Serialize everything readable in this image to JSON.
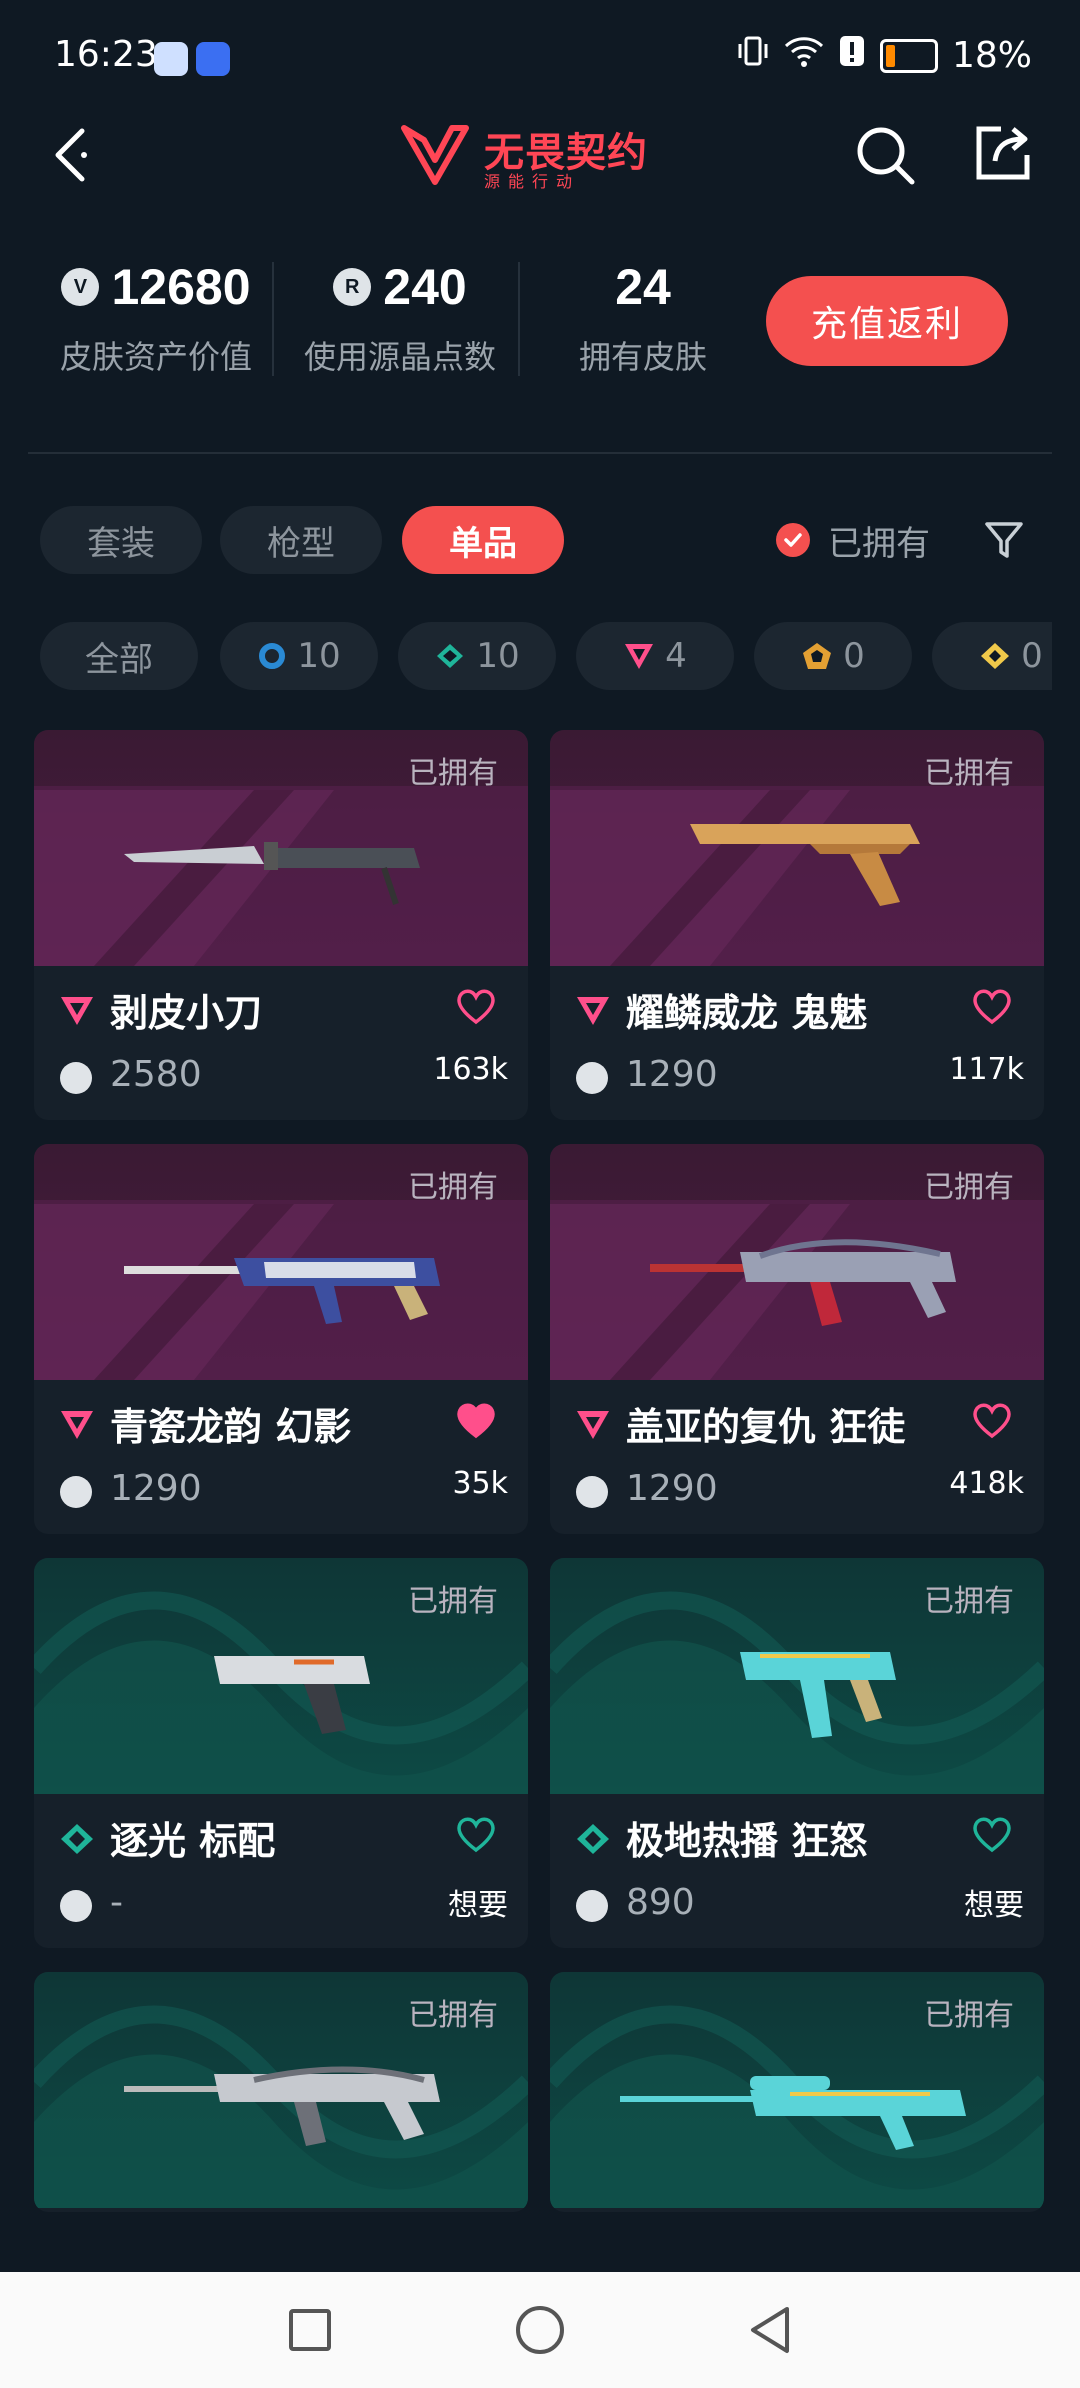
{
  "status_bar": {
    "time": "16:23",
    "battery": "18%"
  },
  "header": {
    "logo_name": "无畏契约",
    "logo_sub": "源能行动"
  },
  "stats": {
    "asset_value": "12680",
    "asset_label": "皮肤资产价值",
    "rp_used": "240",
    "rp_label": "使用源晶点数",
    "skins_owned": "24",
    "skins_label": "拥有皮肤",
    "recharge_label": "充值返利",
    "rp_icon_letter": "R"
  },
  "tabs": [
    {
      "label": "套装"
    },
    {
      "label": "枪型"
    },
    {
      "label": "单品"
    }
  ],
  "owned_filter_label": "已拥有",
  "tier_chips": [
    {
      "label": "全部"
    },
    {
      "label": "10"
    },
    {
      "label": "10"
    },
    {
      "label": "4"
    },
    {
      "label": "0"
    },
    {
      "label": "0"
    }
  ],
  "colors": {
    "accent": "#f4504f",
    "premium": "#ff4f8b",
    "deluxe": "#1fb59a",
    "select": "#2a8ad4",
    "exclusive": "#e3a033",
    "ultra": "#f0c94a"
  },
  "cards": [
    {
      "owned": "已拥有",
      "title": "剥皮小刀",
      "price": "2580",
      "likes": "163k",
      "tier": "premium",
      "liked": false
    },
    {
      "owned": "已拥有",
      "title": "耀鳞威龙 鬼魅",
      "price": "1290",
      "likes": "117k",
      "tier": "premium",
      "liked": false
    },
    {
      "owned": "已拥有",
      "title": "青瓷龙韵 幻影",
      "price": "1290",
      "likes": "35k",
      "tier": "premium",
      "liked": true
    },
    {
      "owned": "已拥有",
      "title": "盖亚的复仇 狂徒",
      "price": "1290",
      "likes": "418k",
      "tier": "premium",
      "liked": false
    },
    {
      "owned": "已拥有",
      "title": "逐光 标配",
      "price": "-",
      "likes": "想要",
      "tier": "deluxe",
      "liked": false
    },
    {
      "owned": "已拥有",
      "title": "极地热播 狂怒",
      "price": "890",
      "likes": "想要",
      "tier": "deluxe",
      "liked": false
    },
    {
      "owned": "已拥有",
      "title": "",
      "price": "",
      "likes": "",
      "tier": "deluxe",
      "liked": false
    },
    {
      "owned": "已拥有",
      "title": "",
      "price": "",
      "likes": "",
      "tier": "deluxe",
      "liked": false
    }
  ]
}
